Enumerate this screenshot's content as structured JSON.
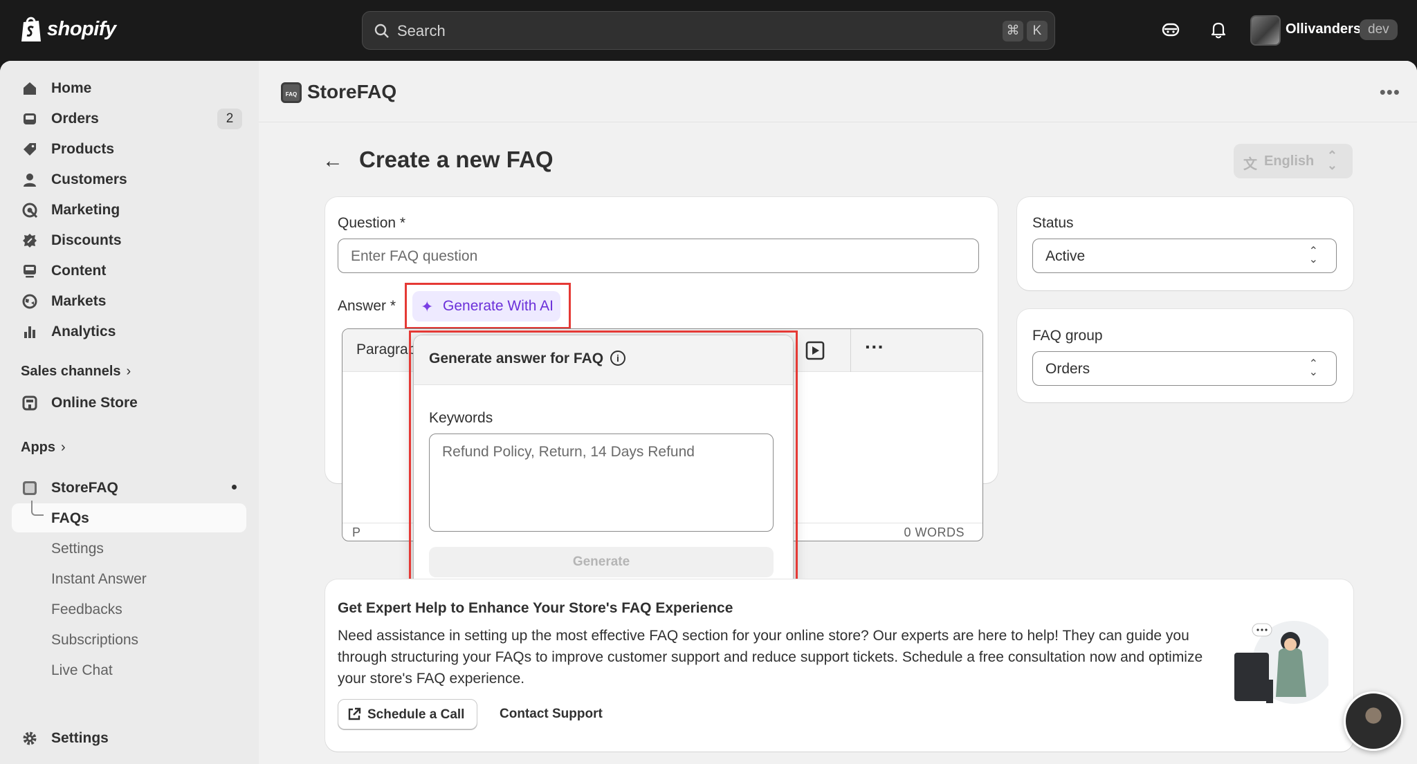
{
  "topbar": {
    "brand": "shopify",
    "search_placeholder": "Search",
    "shortcut_keys": [
      "⌘",
      "K"
    ],
    "store_name": "Ollivanders",
    "store_badge": "dev"
  },
  "sidebar": {
    "items": [
      {
        "label": "Home",
        "icon": "home-icon"
      },
      {
        "label": "Orders",
        "icon": "orders-icon",
        "count": "2"
      },
      {
        "label": "Products",
        "icon": "tag-icon"
      },
      {
        "label": "Customers",
        "icon": "person-icon"
      },
      {
        "label": "Marketing",
        "icon": "target-icon"
      },
      {
        "label": "Discounts",
        "icon": "discount-icon"
      },
      {
        "label": "Content",
        "icon": "content-icon"
      },
      {
        "label": "Markets",
        "icon": "globe-icon"
      },
      {
        "label": "Analytics",
        "icon": "bar-chart-icon"
      }
    ],
    "sales_channels_heading": "Sales channels",
    "online_store": "Online Store",
    "apps_heading": "Apps",
    "app_name": "StoreFAQ",
    "app_subitems": [
      "FAQs",
      "Settings",
      "Instant Answer",
      "Feedbacks",
      "Subscriptions",
      "Live Chat"
    ],
    "settings": "Settings"
  },
  "app_header": {
    "logo_text": "FAQ",
    "title": "StoreFAQ"
  },
  "page": {
    "title": "Create a new FAQ",
    "language": "English"
  },
  "form": {
    "question_label": "Question *",
    "question_placeholder": "Enter FAQ question",
    "answer_label": "Answer *",
    "generate_ai_label": "Generate With AI",
    "editor_block_type": "Paragraph",
    "editor_path": "P",
    "word_count": "0 WORDS"
  },
  "popover": {
    "title": "Generate answer for FAQ",
    "keywords_label": "Keywords",
    "keywords_placeholder": "Refund Policy, Return, 14 Days Refund",
    "generate_button": "Generate"
  },
  "status_card": {
    "label": "Status",
    "value": "Active"
  },
  "group_card": {
    "label": "FAQ group",
    "value": "Orders"
  },
  "expert_card": {
    "title": "Get Expert Help to Enhance Your Store's FAQ Experience",
    "body": "Need assistance in setting up the most effective FAQ section for your online store? Our experts are here to help! They can guide you through structuring your FAQs to improve customer support and reduce support tickets. Schedule a free consultation now and optimize your store's FAQ experience.",
    "schedule_button": "Schedule a Call",
    "contact_link": "Contact Support"
  },
  "colors": {
    "highlight_border": "#e53935",
    "ai_accent": "#6b30d9"
  }
}
